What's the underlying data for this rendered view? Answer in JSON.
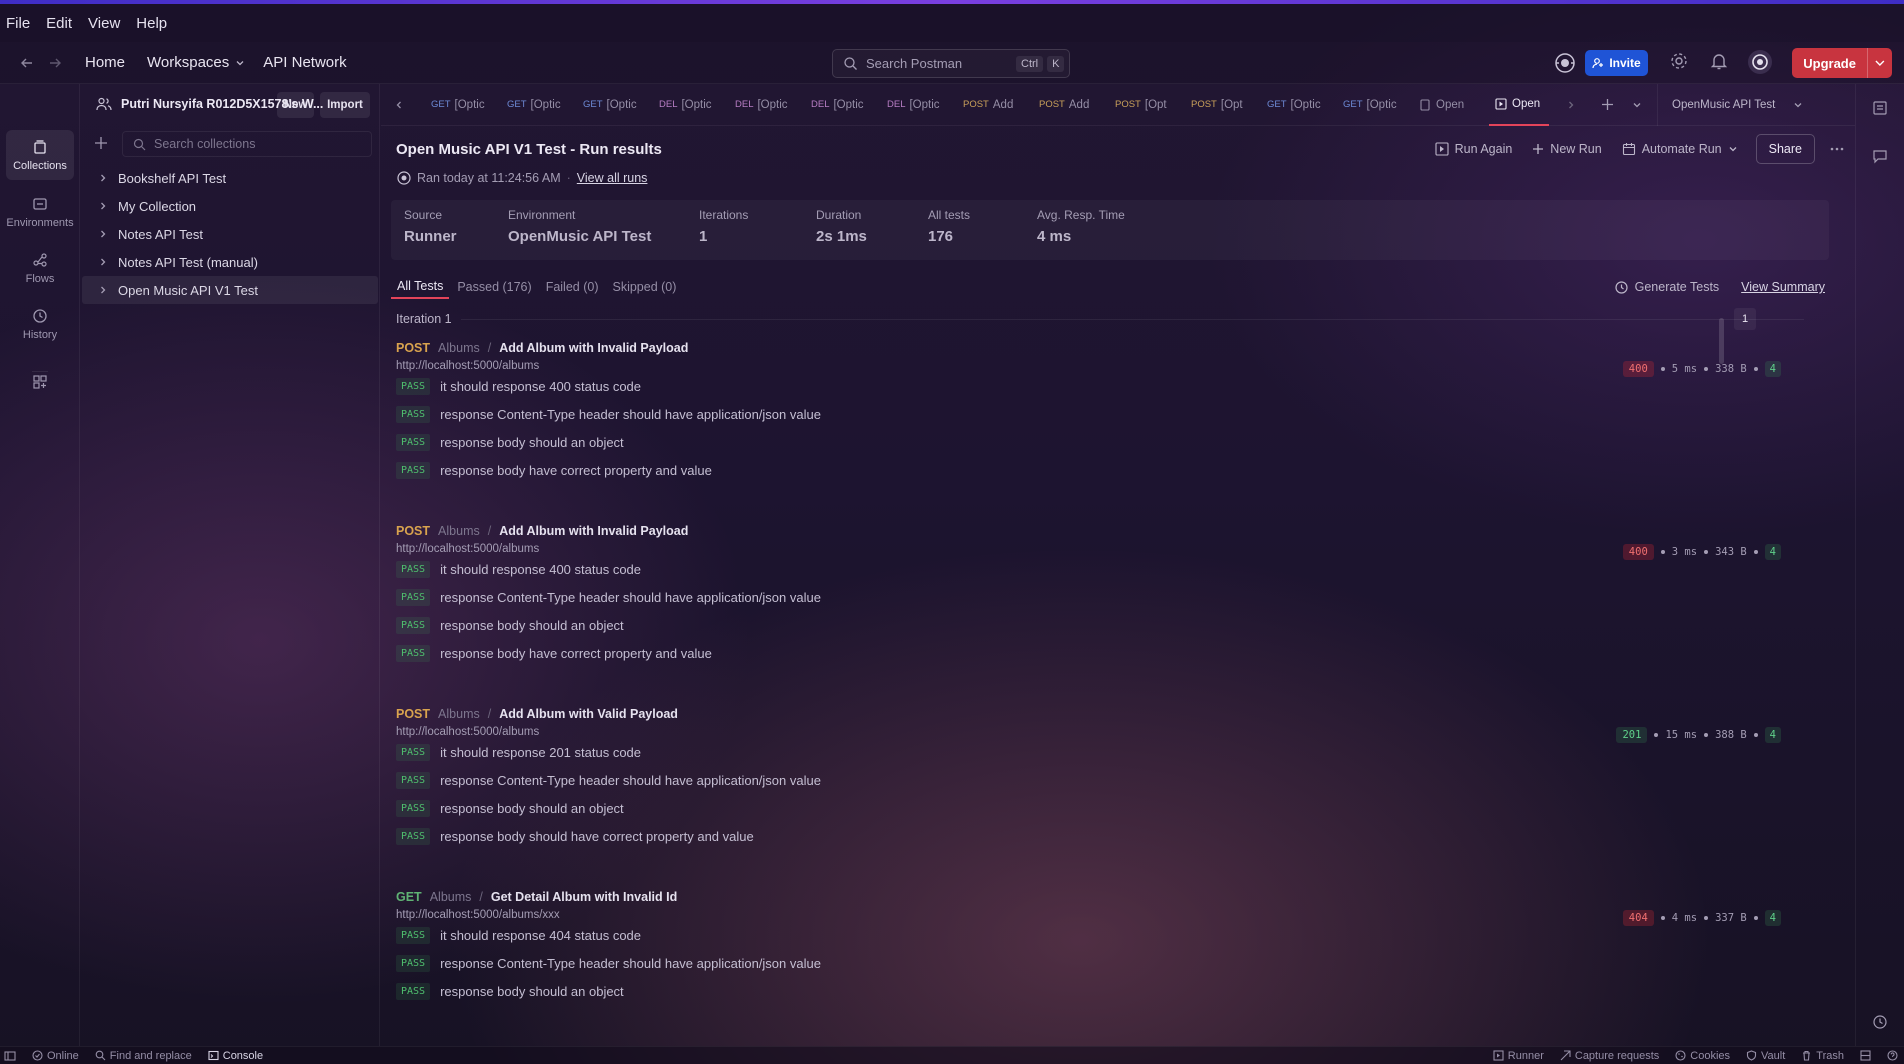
{
  "menu": [
    "File",
    "Edit",
    "View",
    "Help"
  ],
  "header": {
    "nav": [
      "Home",
      "Workspaces",
      "API Network"
    ],
    "search_placeholder": "Search Postman",
    "shortcut": [
      "Ctrl",
      "K"
    ],
    "invite_label": "Invite",
    "upgrade_label": "Upgrade"
  },
  "rail": {
    "items": [
      "Collections",
      "Environments",
      "Flows",
      "History"
    ]
  },
  "sidebar": {
    "workspace_name": "Putri Nursyifa R012D5X1578's W...",
    "new_label": "New",
    "import_label": "Import",
    "search_placeholder": "Search collections",
    "collections": [
      "Bookshelf API Test",
      "My Collection",
      "Notes API Test",
      "Notes API Test (manual)",
      "Open Music API V1 Test"
    ]
  },
  "tabs": [
    {
      "method": "GET",
      "label": "[Optic"
    },
    {
      "method": "GET",
      "label": "[Optic"
    },
    {
      "method": "GET",
      "label": "[Optic"
    },
    {
      "method": "DEL",
      "label": "[Optic"
    },
    {
      "method": "DEL",
      "label": "[Optic"
    },
    {
      "method": "DEL",
      "label": "[Optic"
    },
    {
      "method": "DEL",
      "label": "[Optic"
    },
    {
      "method": "POST",
      "label": "Add"
    },
    {
      "method": "POST",
      "label": "Add"
    },
    {
      "method": "POST",
      "label": "[Opt"
    },
    {
      "method": "POST",
      "label": "[Opt"
    },
    {
      "method": "GET",
      "label": "[Optic"
    },
    {
      "method": "GET",
      "label": "[Optic"
    },
    {
      "method": "",
      "label": "Open"
    },
    {
      "method": "",
      "label": "Open"
    }
  ],
  "environment_selector": "OpenMusic API Test",
  "run": {
    "title": "Open Music API V1 Test - Run results",
    "ran_at": "Ran today at 11:24:56 AM",
    "view_all_runs": "View all runs",
    "actions": {
      "run_again": "Run Again",
      "new_run": "New Run",
      "automate_run": "Automate Run",
      "share": "Share"
    },
    "summary": [
      {
        "label": "Source",
        "value": "Runner"
      },
      {
        "label": "Environment",
        "value": "OpenMusic API Test"
      },
      {
        "label": "Iterations",
        "value": "1"
      },
      {
        "label": "Duration",
        "value": "2s 1ms"
      },
      {
        "label": "All tests",
        "value": "176"
      },
      {
        "label": "Avg. Resp. Time",
        "value": "4 ms"
      }
    ],
    "filters": [
      "All Tests",
      "Passed (176)",
      "Failed (0)",
      "Skipped (0)"
    ],
    "generate_tests": "Generate Tests",
    "view_summary": "View Summary",
    "iteration_label": "Iteration 1",
    "iteration_number": "1",
    "pass_label": "PASS",
    "requests": [
      {
        "method": "POST",
        "folder": "Albums",
        "name": "Add Album with Invalid Payload",
        "url": "http://localhost:5000/albums",
        "status": "400",
        "time": "5 ms",
        "size": "338 B",
        "count": "4",
        "tests": [
          "it should response 400 status code",
          "response Content-Type header should have application/json value",
          "response body should an object",
          "response body have correct property and value"
        ]
      },
      {
        "method": "POST",
        "folder": "Albums",
        "name": "Add Album with Invalid Payload",
        "url": "http://localhost:5000/albums",
        "status": "400",
        "time": "3 ms",
        "size": "343 B",
        "count": "4",
        "tests": [
          "it should response 400 status code",
          "response Content-Type header should have application/json value",
          "response body should an object",
          "response body have correct property and value"
        ]
      },
      {
        "method": "POST",
        "folder": "Albums",
        "name": "Add Album with Valid Payload",
        "url": "http://localhost:5000/albums",
        "status": "201",
        "time": "15 ms",
        "size": "388 B",
        "count": "4",
        "tests": [
          "it should response 201 status code",
          "response Content-Type header should have application/json value",
          "response body should an object",
          "response body should have correct property and value"
        ]
      },
      {
        "method": "GET",
        "folder": "Albums",
        "name": "Get Detail Album with Invalid Id",
        "url": "http://localhost:5000/albums/xxx",
        "status": "404",
        "time": "4 ms",
        "size": "337 B",
        "count": "4",
        "tests": [
          "it should response 404 status code",
          "response Content-Type header should have application/json value",
          "response body should an object"
        ]
      }
    ]
  },
  "statusbar": {
    "left": [
      "Online",
      "Find and replace",
      "Console"
    ],
    "right": [
      "Runner",
      "Capture requests",
      "Cookies",
      "Vault",
      "Trash"
    ]
  }
}
